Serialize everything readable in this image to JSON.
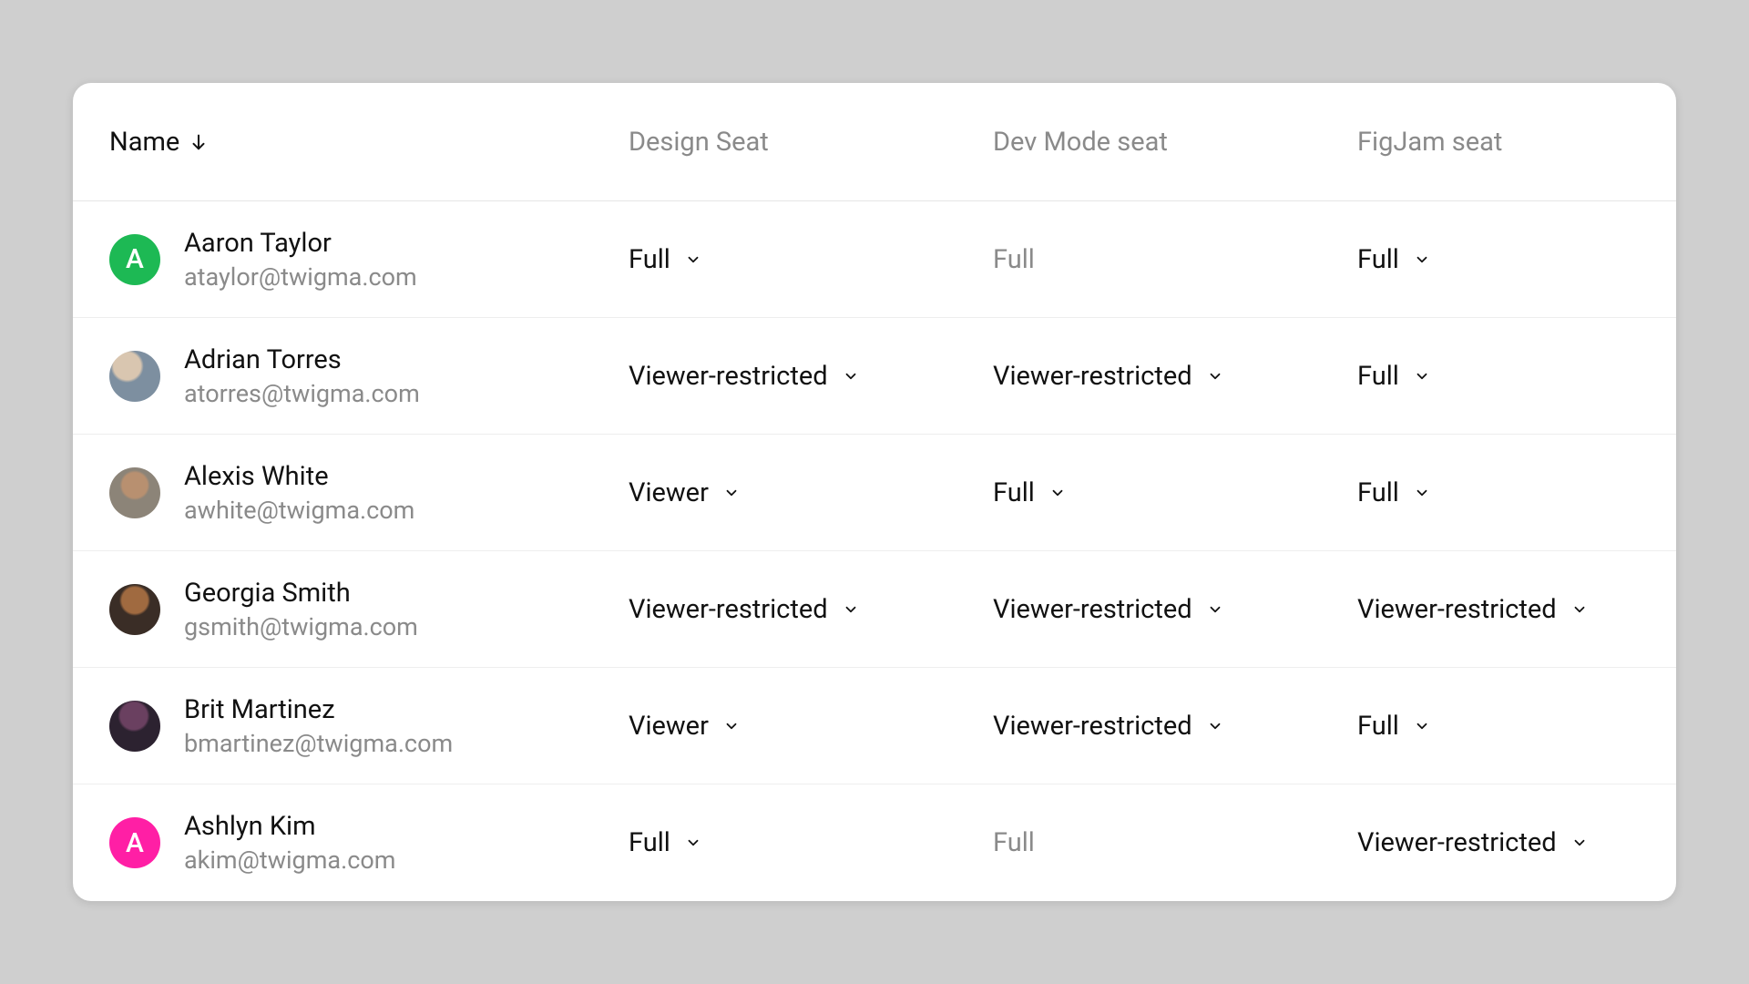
{
  "columns": {
    "name": "Name",
    "design": "Design Seat",
    "dev": "Dev Mode seat",
    "figjam": "FigJam seat"
  },
  "users": [
    {
      "name": "Aaron Taylor",
      "email": "ataylor@twigma.com",
      "avatar": {
        "type": "initial",
        "letter": "A",
        "color": "#1db954"
      },
      "design": {
        "label": "Full",
        "locked": false
      },
      "dev": {
        "label": "Full",
        "locked": true
      },
      "figjam": {
        "label": "Full",
        "locked": false
      }
    },
    {
      "name": "Adrian Torres",
      "email": "atorres@twigma.com",
      "avatar": {
        "type": "photo",
        "class": "ph1"
      },
      "design": {
        "label": "Viewer-restricted",
        "locked": false
      },
      "dev": {
        "label": "Viewer-restricted",
        "locked": false
      },
      "figjam": {
        "label": "Full",
        "locked": false
      }
    },
    {
      "name": "Alexis White",
      "email": "awhite@twigma.com",
      "avatar": {
        "type": "photo",
        "class": "ph2"
      },
      "design": {
        "label": "Viewer",
        "locked": false
      },
      "dev": {
        "label": "Full",
        "locked": false
      },
      "figjam": {
        "label": "Full",
        "locked": false
      }
    },
    {
      "name": "Georgia Smith",
      "email": "gsmith@twigma.com",
      "avatar": {
        "type": "photo",
        "class": "ph3"
      },
      "design": {
        "label": "Viewer-restricted",
        "locked": false
      },
      "dev": {
        "label": "Viewer-restricted",
        "locked": false
      },
      "figjam": {
        "label": "Viewer-restricted",
        "locked": false
      }
    },
    {
      "name": "Brit Martinez",
      "email": "bmartinez@twigma.com",
      "avatar": {
        "type": "photo",
        "class": "ph4"
      },
      "design": {
        "label": "Viewer",
        "locked": false
      },
      "dev": {
        "label": "Viewer-restricted",
        "locked": false
      },
      "figjam": {
        "label": "Full",
        "locked": false
      }
    },
    {
      "name": "Ashlyn Kim",
      "email": "akim@twigma.com",
      "avatar": {
        "type": "initial",
        "letter": "A",
        "color": "#ff1fa5"
      },
      "design": {
        "label": "Full",
        "locked": false
      },
      "dev": {
        "label": "Full",
        "locked": true
      },
      "figjam": {
        "label": "Viewer-restricted",
        "locked": false
      }
    }
  ]
}
